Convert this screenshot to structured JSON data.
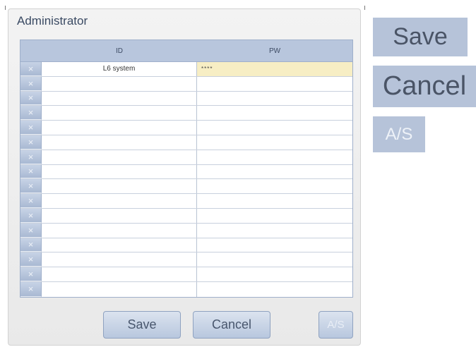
{
  "dialog": {
    "title": "Administrator",
    "columns": {
      "delete": "",
      "id": "ID",
      "pw": "PW"
    },
    "delete_glyph": "×",
    "rows": [
      {
        "id": "L6 system",
        "pw": "****"
      },
      {
        "id": "",
        "pw": ""
      },
      {
        "id": "",
        "pw": ""
      },
      {
        "id": "",
        "pw": ""
      },
      {
        "id": "",
        "pw": ""
      },
      {
        "id": "",
        "pw": ""
      },
      {
        "id": "",
        "pw": ""
      },
      {
        "id": "",
        "pw": ""
      },
      {
        "id": "",
        "pw": ""
      },
      {
        "id": "",
        "pw": ""
      },
      {
        "id": "",
        "pw": ""
      },
      {
        "id": "",
        "pw": ""
      },
      {
        "id": "",
        "pw": ""
      },
      {
        "id": "",
        "pw": ""
      },
      {
        "id": "",
        "pw": ""
      },
      {
        "id": "",
        "pw": ""
      }
    ],
    "buttons": {
      "save": "Save",
      "cancel": "Cancel",
      "as": "A/S"
    }
  },
  "legend": {
    "save": "Save",
    "cancel": "Cancel",
    "as": "A/S"
  },
  "colors": {
    "header": "#b8c6dd",
    "button": "#b8c7de",
    "highlight": "#f7eec4"
  }
}
